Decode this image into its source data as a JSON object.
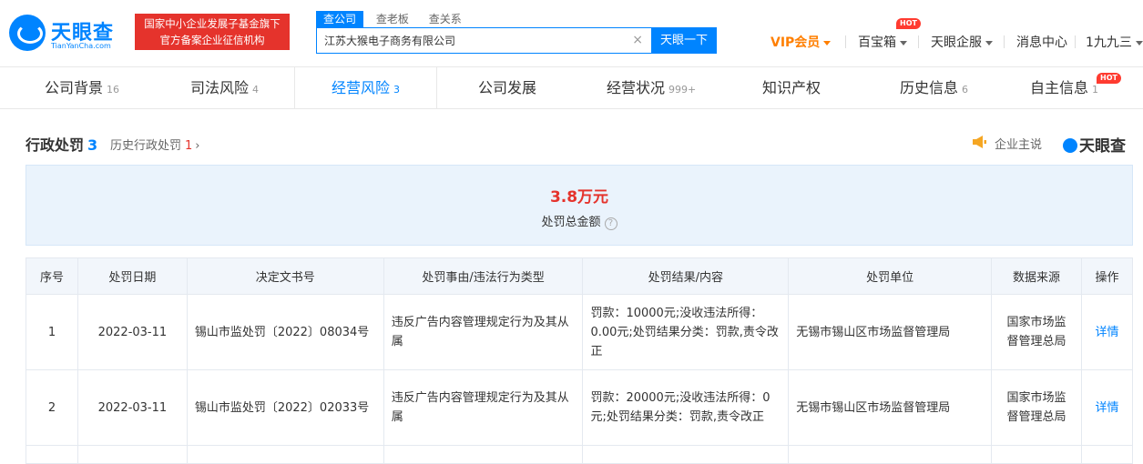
{
  "header": {
    "logo": {
      "text": "天眼查",
      "subtext": "TianYanCha.com"
    },
    "banner": {
      "line1": "国家中小企业发展子基金旗下",
      "line2": "官方备案企业征信机构"
    },
    "search_tabs": [
      {
        "label": "查公司",
        "active": true
      },
      {
        "label": "查老板",
        "active": false
      },
      {
        "label": "查关系",
        "active": false
      }
    ],
    "search_value": "江苏大猴电子商务有限公司",
    "search_button": "天眼一下",
    "nav": {
      "vip": "VIP会员",
      "treasure": "百宝箱",
      "treasure_badge": "HOT",
      "enterprise": "天眼企服",
      "messages": "消息中心",
      "user": "1九九三"
    }
  },
  "tabs": [
    {
      "label": "公司背景",
      "count": "16",
      "active": false
    },
    {
      "label": "司法风险",
      "count": "4",
      "active": false
    },
    {
      "label": "经营风险",
      "count": "3",
      "active": true
    },
    {
      "label": "公司发展",
      "count": "",
      "active": false
    },
    {
      "label": "经营状况",
      "count": "999+",
      "active": false
    },
    {
      "label": "知识产权",
      "count": "",
      "active": false
    },
    {
      "label": "历史信息",
      "count": "6",
      "active": false
    },
    {
      "label": "自主信息",
      "count": "1",
      "active": false,
      "badge": "HOT"
    }
  ],
  "section": {
    "title": "行政处罚",
    "count": "3",
    "history_label": "历史行政处罚",
    "history_count": "1",
    "owner_say": "企业主说",
    "brand": "天眼查"
  },
  "summary": {
    "amount": "3.8万元",
    "label": "处罚总金额"
  },
  "table": {
    "headers": [
      "序号",
      "处罚日期",
      "决定文书号",
      "处罚事由/违法行为类型",
      "处罚结果/内容",
      "处罚单位",
      "数据来源",
      "操作"
    ],
    "rows": [
      {
        "index": "1",
        "date": "2022-03-11",
        "doc_no": "锡山市监处罚〔2022〕08034号",
        "reason": "违反广告内容管理规定行为及其从属",
        "result": "罚款：10000元;没收违法所得：0.00元;处罚结果分类：罚款,责令改正",
        "unit": "无锡市锡山区市场监督管理局",
        "source": "国家市场监督管理总局",
        "action": "详情"
      },
      {
        "index": "2",
        "date": "2022-03-11",
        "doc_no": "锡山市监处罚〔2022〕02033号",
        "reason": "违反广告内容管理规定行为及其从属",
        "result": "罚款：20000元;没收违法所得：0元;处罚结果分类：罚款,责令改正",
        "unit": "无锡市锡山区市场监督管理局",
        "source": "国家市场监督管理总局",
        "action": "详情"
      }
    ]
  },
  "colors": {
    "brand_blue": "#0084ff",
    "alert_red": "#e5332c",
    "vip_orange": "#ff7f00",
    "summary_bg": "#eaf3fc"
  }
}
